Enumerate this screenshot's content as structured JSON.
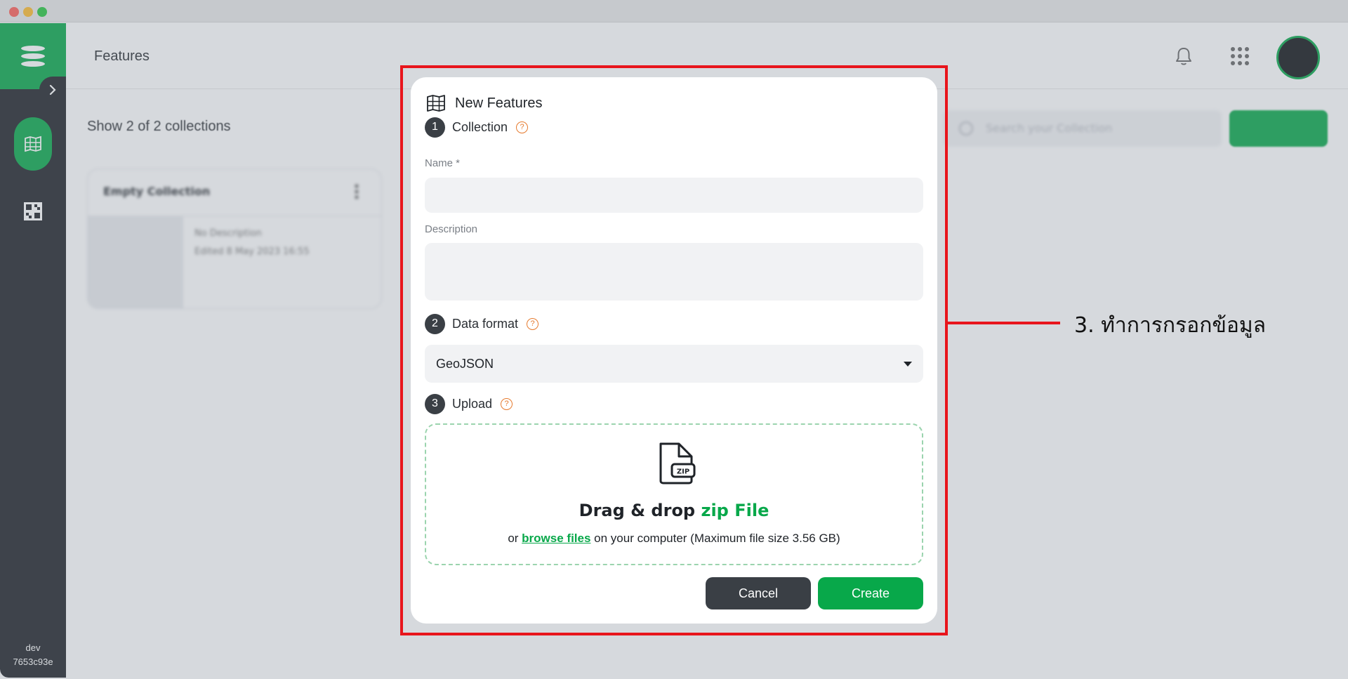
{
  "app": {
    "page_title": "Features",
    "env_name": "dev",
    "env_build": "7653c93e"
  },
  "content": {
    "show_count": "Show 2 of 2 collections",
    "search_placeholder": "Search your Collection",
    "collection_card": {
      "title": "Empty Collection",
      "description": "No Description",
      "edited": "Edited 8 May 2023 16:55"
    }
  },
  "modal": {
    "title": "New Features",
    "steps": [
      {
        "num": "1",
        "label": "Collection"
      },
      {
        "num": "2",
        "label": "Data format"
      },
      {
        "num": "3",
        "label": "Upload"
      }
    ],
    "help_glyph": "?",
    "name_label": "Name *",
    "name_value": "",
    "description_label": "Description",
    "description_value": "",
    "format_selected": "GeoJSON",
    "upload": {
      "title_prefix": "Drag & drop",
      "title_accent": "zip File",
      "sub_before": "or",
      "browse_link": "browse files",
      "sub_after": "on your computer (Maximum file size 3.56 GB)",
      "file_badge": "ZIP"
    },
    "cancel_label": "Cancel",
    "create_label": "Create"
  },
  "annotation": {
    "text": "3. ทำการกรอกข้อมูล",
    "color": "#e8151c"
  },
  "colors": {
    "brand_green": "#08a84a",
    "sidebar_dark": "#1f2328",
    "button_dark": "#3a3f45",
    "help_orange": "#e67a2e"
  },
  "icons": {
    "logo": "layers-logo-icon",
    "expand": "chevron-right-icon",
    "nav_features": "map-grid-icon",
    "nav_tiles": "grid-tiles-icon",
    "notifications": "bell-icon",
    "apps": "apps-grid-icon",
    "modal_title": "map-icon",
    "upload": "zip-file-icon"
  }
}
